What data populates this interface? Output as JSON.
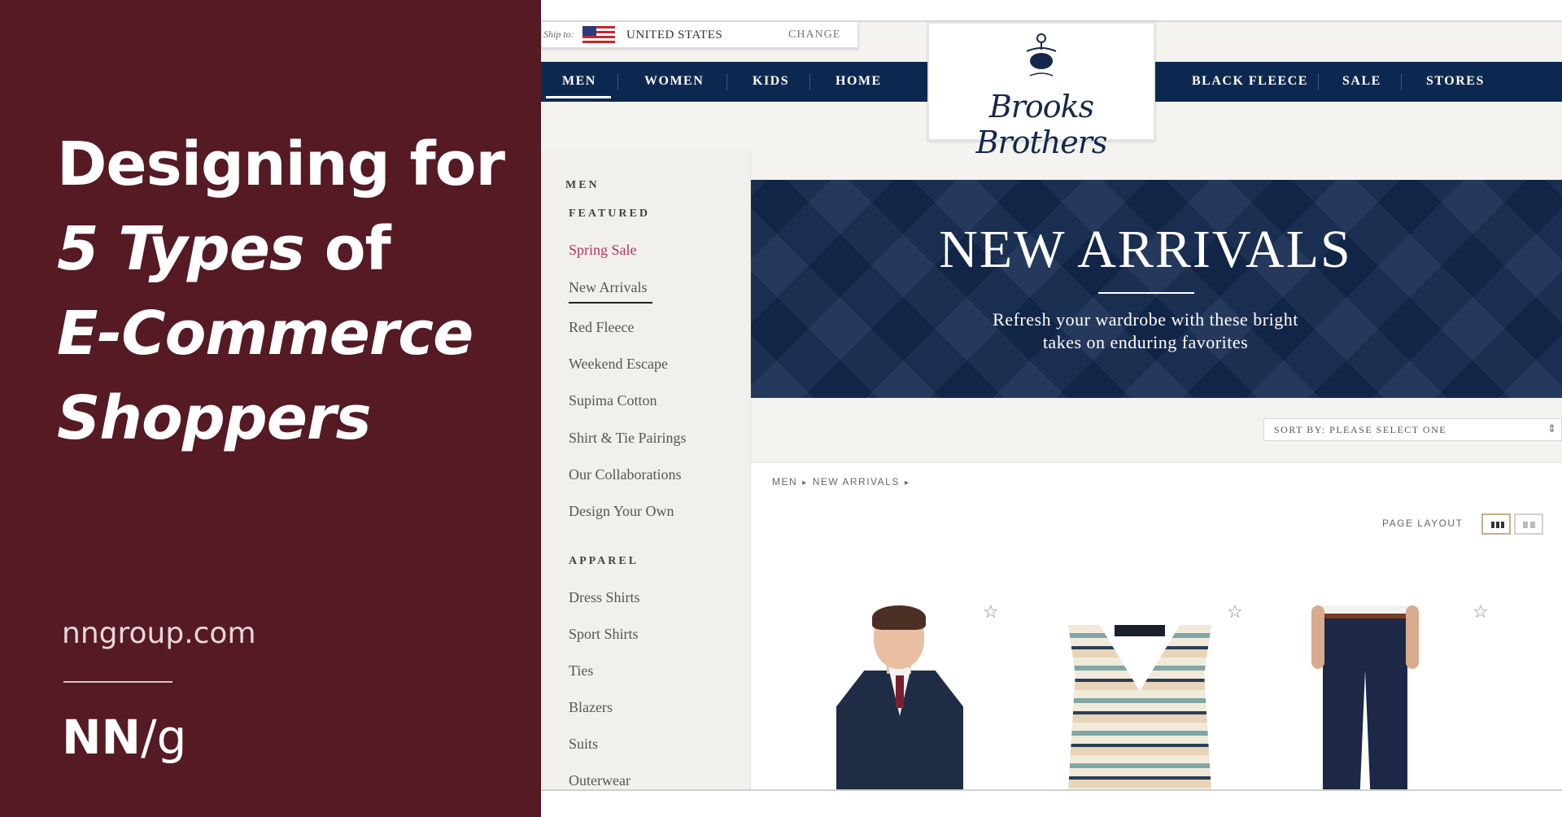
{
  "banner": {
    "headline": {
      "line1": "Designing for",
      "line2_italic": "5 Types",
      "line2_rest": " of",
      "line3_italic": "E-Commerce",
      "line4_italic": "Shoppers"
    },
    "site_url": "nngroup.com",
    "logo_nn": "NN",
    "logo_g": "/g",
    "background_color": "#551a24"
  },
  "store": {
    "ship_to": {
      "label": "Ship to:",
      "country": "UNITED STATES",
      "change": "CHANGE"
    },
    "nav_left": [
      "MEN",
      "WOMEN",
      "KIDS",
      "HOME"
    ],
    "nav_right": [
      "BLACK FLEECE",
      "SALE",
      "STORES"
    ],
    "brand": "Brooks Brothers",
    "nav_color": "#0d2850",
    "sidebar": {
      "section_men": "MEN",
      "section_featured": "FEATURED",
      "featured_links": [
        "Spring Sale",
        "New Arrivals",
        "Red Fleece",
        "Weekend Escape",
        "Supima Cotton",
        "Shirt & Tie Pairings",
        "Our Collaborations",
        "Design Your Own"
      ],
      "section_apparel": "APPAREL",
      "apparel_links": [
        "Dress Shirts",
        "Sport Shirts",
        "Ties",
        "Blazers",
        "Suits",
        "Outerwear"
      ]
    },
    "hero": {
      "title": "NEW ARRIVALS",
      "subtitle_line1": "Refresh your wardrobe with these bright",
      "subtitle_line2": "takes on enduring favorites"
    },
    "sort": {
      "label": "SORT BY: PLEASE SELECT ONE"
    },
    "breadcrumb": [
      "MEN",
      "NEW ARRIVALS"
    ],
    "page_layout_label": "PAGE LAYOUT",
    "products": [
      {
        "image": "model-in-suit"
      },
      {
        "image": "sweater-vest"
      },
      {
        "image": "navy-trousers"
      }
    ]
  }
}
